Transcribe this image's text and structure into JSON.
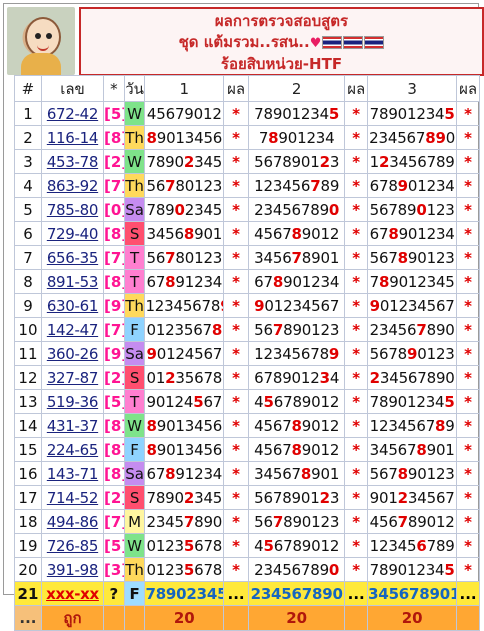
{
  "header": {
    "line1": "ผลการตรวจสอบสูตร",
    "line2": "ชุด แต้มรวม..รสน..",
    "line3": "ร้อยสิบหน่วย-HTF"
  },
  "table": {
    "columns": [
      "#",
      "เลข",
      "*",
      "วัน",
      "1",
      "ผล",
      "2",
      "ผล",
      "3",
      "ผล"
    ],
    "rows": [
      {
        "n": "1",
        "lek": "672-42",
        "d": "[5]",
        "day": "W",
        "dc": "#7ee38a",
        "s": [
          [
            "4",
            "5",
            "6",
            "7",
            "9",
            "0",
            "1",
            "2"
          ],
          [
            "7",
            "8",
            "9",
            "0",
            "1",
            "2",
            "3",
            "4",
            "5"
          ],
          [
            "7",
            "8",
            "9",
            "0",
            "1",
            "2",
            "3",
            "4",
            "5"
          ]
        ],
        "h": [
          [],
          [
            8
          ],
          [
            8
          ]
        ]
      },
      {
        "n": "2",
        "lek": "116-14",
        "d": "[8]",
        "day": "Th",
        "dc": "#ffd95c",
        "s": [
          [
            "8",
            "9",
            "0",
            "1",
            "3",
            "4",
            "5",
            "6"
          ],
          [
            "7",
            "8",
            "9",
            "0",
            "1",
            "2",
            "3",
            "4"
          ],
          [
            "2",
            "3",
            "4",
            "5",
            "6",
            "7",
            "8",
            "9",
            "0"
          ]
        ],
        "h": [
          [
            0
          ],
          [
            1
          ],
          [
            6,
            7
          ]
        ]
      },
      {
        "n": "3",
        "lek": "453-78",
        "d": "[2]",
        "day": "W",
        "dc": "#7ee38a",
        "s": [
          [
            "7",
            "8",
            "9",
            "0",
            "2",
            "3",
            "4",
            "5"
          ],
          [
            "5",
            "6",
            "7",
            "8",
            "9",
            "0",
            "1",
            "2",
            "3"
          ],
          [
            "1",
            "2",
            "3",
            "4",
            "5",
            "6",
            "7",
            "8",
            "9"
          ]
        ],
        "h": [
          [
            4
          ],
          [
            7
          ],
          [
            1
          ]
        ]
      },
      {
        "n": "4",
        "lek": "863-92",
        "d": "[7]",
        "day": "Th",
        "dc": "#ffd95c",
        "s": [
          [
            "5",
            "6",
            "7",
            "8",
            "0",
            "1",
            "2",
            "3"
          ],
          [
            "1",
            "2",
            "3",
            "4",
            "5",
            "6",
            "7",
            "8",
            "9"
          ],
          [
            "6",
            "7",
            "8",
            "9",
            "0",
            "1",
            "2",
            "3",
            "4"
          ]
        ],
        "h": [
          [
            2
          ],
          [
            6
          ],
          [
            3
          ]
        ]
      },
      {
        "n": "5",
        "lek": "785-80",
        "d": "[0]",
        "day": "Sa",
        "dc": "#c58cf0",
        "s": [
          [
            "7",
            "8",
            "9",
            "0",
            "2",
            "3",
            "4",
            "5"
          ],
          [
            "2",
            "3",
            "4",
            "5",
            "6",
            "7",
            "8",
            "9",
            "0"
          ],
          [
            "5",
            "6",
            "7",
            "8",
            "9",
            "0",
            "1",
            "2",
            "3"
          ]
        ],
        "h": [
          [
            3
          ],
          [
            8
          ],
          [
            5
          ]
        ]
      },
      {
        "n": "6",
        "lek": "729-40",
        "d": "[8]",
        "day": "S",
        "dc": "#ff4f6f",
        "s": [
          [
            "3",
            "4",
            "5",
            "6",
            "8",
            "9",
            "0",
            "1"
          ],
          [
            "4",
            "5",
            "6",
            "7",
            "8",
            "9",
            "0",
            "1",
            "2"
          ],
          [
            "6",
            "7",
            "8",
            "9",
            "0",
            "1",
            "2",
            "3",
            "4"
          ]
        ],
        "h": [
          [
            4
          ],
          [
            4
          ],
          [
            2
          ]
        ]
      },
      {
        "n": "7",
        "lek": "656-35",
        "d": "[7]",
        "day": "T",
        "dc": "#ff7fd0",
        "s": [
          [
            "5",
            "6",
            "7",
            "8",
            "0",
            "1",
            "2",
            "3"
          ],
          [
            "3",
            "4",
            "5",
            "6",
            "7",
            "8",
            "9",
            "0",
            "1"
          ],
          [
            "5",
            "6",
            "7",
            "8",
            "9",
            "0",
            "1",
            "2",
            "3"
          ]
        ],
        "h": [
          [
            2
          ],
          [
            4
          ],
          [
            3
          ]
        ]
      },
      {
        "n": "8",
        "lek": "891-53",
        "d": "[8]",
        "day": "T",
        "dc": "#ff7fd0",
        "s": [
          [
            "6",
            "7",
            "8",
            "9",
            "1",
            "2",
            "3",
            "4"
          ],
          [
            "6",
            "7",
            "8",
            "9",
            "0",
            "1",
            "2",
            "3",
            "4"
          ],
          [
            "7",
            "8",
            "9",
            "0",
            "1",
            "2",
            "3",
            "4",
            "5"
          ]
        ],
        "h": [
          [
            2
          ],
          [
            2
          ],
          [
            1
          ]
        ]
      },
      {
        "n": "9",
        "lek": "630-61",
        "d": "[9]",
        "day": "Th",
        "dc": "#ffd95c",
        "s": [
          [
            "1",
            "2",
            "3",
            "4",
            "5",
            "6",
            "7",
            "8",
            "9"
          ],
          [
            "9",
            "0",
            "1",
            "2",
            "3",
            "4",
            "5",
            "6",
            "7"
          ],
          [
            "9",
            "0",
            "1",
            "2",
            "3",
            "4",
            "5",
            "6",
            "7"
          ]
        ],
        "h": [
          [
            8
          ],
          [
            0
          ],
          [
            0
          ]
        ]
      },
      {
        "n": "10",
        "lek": "142-47",
        "d": "[7]",
        "day": "F",
        "dc": "#8fd3ff",
        "s": [
          [
            "0",
            "1",
            "2",
            "3",
            "5",
            "6",
            "7",
            "8"
          ],
          [
            "5",
            "6",
            "7",
            "8",
            "9",
            "0",
            "1",
            "2",
            "3"
          ],
          [
            "2",
            "3",
            "4",
            "5",
            "6",
            "7",
            "8",
            "9",
            "0"
          ]
        ],
        "h": [
          [
            7
          ],
          [
            2
          ],
          [
            5
          ]
        ]
      },
      {
        "n": "11",
        "lek": "360-26",
        "d": "[9]",
        "day": "Sa",
        "dc": "#c58cf0",
        "s": [
          [
            "9",
            "0",
            "1",
            "2",
            "4",
            "5",
            "6",
            "7"
          ],
          [
            "1",
            "2",
            "3",
            "4",
            "5",
            "6",
            "7",
            "8",
            "9"
          ],
          [
            "5",
            "6",
            "7",
            "8",
            "9",
            "0",
            "1",
            "2",
            "3"
          ]
        ],
        "h": [
          [
            0
          ],
          [
            8
          ],
          [
            4
          ]
        ]
      },
      {
        "n": "12",
        "lek": "327-87",
        "d": "[2]",
        "day": "S",
        "dc": "#ff4f6f",
        "s": [
          [
            "0",
            "1",
            "2",
            "3",
            "5",
            "6",
            "7",
            "8"
          ],
          [
            "6",
            "7",
            "8",
            "9",
            "0",
            "1",
            "2",
            "3",
            "4"
          ],
          [
            "2",
            "3",
            "4",
            "5",
            "6",
            "7",
            "8",
            "9",
            "0"
          ]
        ],
        "h": [
          [
            2
          ],
          [
            7
          ],
          [
            0
          ]
        ]
      },
      {
        "n": "13",
        "lek": "519-36",
        "d": "[5]",
        "day": "T",
        "dc": "#ff7fd0",
        "s": [
          [
            "9",
            "0",
            "1",
            "2",
            "4",
            "5",
            "6",
            "7"
          ],
          [
            "4",
            "5",
            "6",
            "7",
            "8",
            "9",
            "0",
            "1",
            "2"
          ],
          [
            "7",
            "8",
            "9",
            "0",
            "1",
            "2",
            "3",
            "4",
            "5"
          ]
        ],
        "h": [
          [
            5
          ],
          [
            1
          ],
          [
            8
          ]
        ]
      },
      {
        "n": "14",
        "lek": "431-37",
        "d": "[8]",
        "day": "W",
        "dc": "#7ee38a",
        "s": [
          [
            "8",
            "9",
            "0",
            "1",
            "3",
            "4",
            "5",
            "6"
          ],
          [
            "4",
            "5",
            "6",
            "7",
            "8",
            "9",
            "0",
            "1",
            "2"
          ],
          [
            "1",
            "2",
            "3",
            "4",
            "5",
            "6",
            "7",
            "8",
            "9"
          ]
        ],
        "h": [
          [
            0
          ],
          [
            4
          ],
          [
            7
          ]
        ]
      },
      {
        "n": "15",
        "lek": "224-65",
        "d": "[8]",
        "day": "F",
        "dc": "#8fd3ff",
        "s": [
          [
            "8",
            "9",
            "0",
            "1",
            "3",
            "4",
            "5",
            "6"
          ],
          [
            "4",
            "5",
            "6",
            "7",
            "8",
            "9",
            "0",
            "1",
            "2"
          ],
          [
            "3",
            "4",
            "5",
            "6",
            "7",
            "8",
            "9",
            "0",
            "1"
          ]
        ],
        "h": [
          [
            0
          ],
          [
            4
          ],
          [
            5
          ]
        ]
      },
      {
        "n": "16",
        "lek": "143-71",
        "d": "[8]",
        "day": "Sa",
        "dc": "#c58cf0",
        "s": [
          [
            "6",
            "7",
            "8",
            "9",
            "1",
            "2",
            "3",
            "4"
          ],
          [
            "3",
            "4",
            "5",
            "6",
            "7",
            "8",
            "9",
            "0",
            "1"
          ],
          [
            "5",
            "6",
            "7",
            "8",
            "9",
            "0",
            "1",
            "2",
            "3"
          ]
        ],
        "h": [
          [
            2
          ],
          [
            5
          ],
          [
            3
          ]
        ]
      },
      {
        "n": "17",
        "lek": "714-52",
        "d": "[2]",
        "day": "S",
        "dc": "#ff4f6f",
        "s": [
          [
            "7",
            "8",
            "9",
            "0",
            "2",
            "3",
            "4",
            "5"
          ],
          [
            "5",
            "6",
            "7",
            "8",
            "9",
            "0",
            "1",
            "2",
            "3"
          ],
          [
            "9",
            "0",
            "1",
            "2",
            "3",
            "4",
            "5",
            "6",
            "7"
          ]
        ],
        "h": [
          [
            4
          ],
          [
            7
          ],
          [
            3
          ]
        ]
      },
      {
        "n": "18",
        "lek": "494-86",
        "d": "[7]",
        "day": "M",
        "dc": "#fff6a0",
        "s": [
          [
            "2",
            "3",
            "4",
            "5",
            "7",
            "8",
            "9",
            "0"
          ],
          [
            "5",
            "6",
            "7",
            "8",
            "9",
            "0",
            "1",
            "2",
            "3"
          ],
          [
            "4",
            "5",
            "6",
            "7",
            "8",
            "9",
            "0",
            "1",
            "2"
          ]
        ],
        "h": [
          [
            4
          ],
          [
            2
          ],
          [
            3
          ]
        ]
      },
      {
        "n": "19",
        "lek": "726-85",
        "d": "[5]",
        "day": "W",
        "dc": "#7ee38a",
        "s": [
          [
            "0",
            "1",
            "2",
            "3",
            "5",
            "6",
            "7",
            "8"
          ],
          [
            "4",
            "5",
            "6",
            "7",
            "8",
            "9",
            "0",
            "1",
            "2"
          ],
          [
            "1",
            "2",
            "3",
            "4",
            "5",
            "6",
            "7",
            "8",
            "9"
          ]
        ],
        "h": [
          [
            4
          ],
          [
            1
          ],
          [
            5
          ]
        ]
      },
      {
        "n": "20",
        "lek": "391-98",
        "d": "[3]",
        "day": "Th",
        "dc": "#ffd95c",
        "s": [
          [
            "0",
            "1",
            "2",
            "3",
            "5",
            "6",
            "7",
            "8"
          ],
          [
            "2",
            "3",
            "4",
            "5",
            "6",
            "7",
            "8",
            "9",
            "0"
          ],
          [
            "7",
            "8",
            "9",
            "0",
            "1",
            "2",
            "3",
            "4",
            "5"
          ]
        ],
        "h": [
          [
            4
          ],
          [
            8
          ],
          [
            8
          ]
        ]
      }
    ],
    "summary": {
      "n": "21",
      "lek": "xxx-xx",
      "d": "?",
      "day": "F",
      "s1": "78902345",
      "s2": "234567890",
      "s3": "345678901",
      "dots": "..."
    },
    "total": {
      "n": "...",
      "label": "ถูก",
      "c1": "20",
      "c2": "20",
      "c3": "20"
    },
    "mark": "*"
  }
}
